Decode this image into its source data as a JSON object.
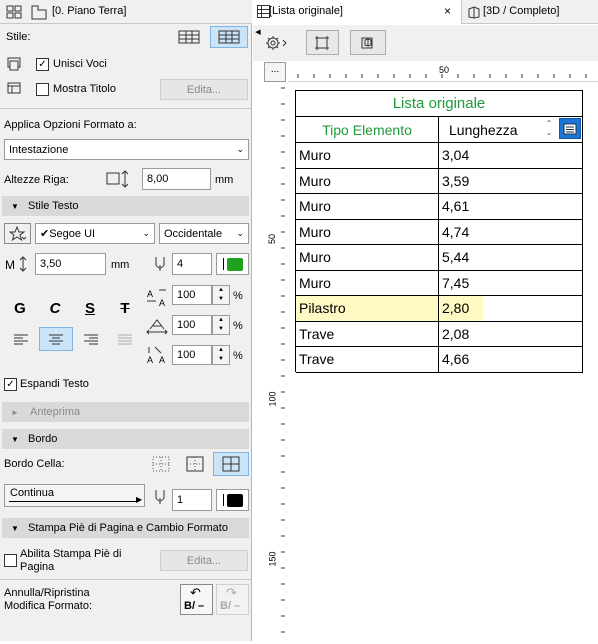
{
  "left_panel": {
    "view_title": "[0. Piano Terra]",
    "stile_label": "Stile:",
    "unisci_voci_label": "Unisci Voci",
    "unisci_voci_checked": true,
    "mostra_titolo_label": "Mostra Titolo",
    "mostra_titolo_checked": false,
    "edita_label": "Edita...",
    "applica_label": "Applica Opzioni Formato a:",
    "applica_value": "Intestazione",
    "altezze_label": "Altezze Riga:",
    "altezze_value": "8,00",
    "altezze_unit": "mm",
    "stile_testo_label": "Stile Testo",
    "font_value": "✔Segoe UI",
    "script_value": "Occidentale",
    "font_size_value": "3,50",
    "font_size_unit": "mm",
    "pen_value": "4",
    "pen_color": "#1fa31f",
    "style_buttons": [
      "G",
      "C",
      "S",
      "T"
    ],
    "width_value": "100",
    "spacing_value": "100",
    "height_value": "100",
    "percent": "%",
    "espandi_label": "Espandi Testo",
    "espandi_checked": true,
    "anteprima_label": "Anteprima",
    "bordo_label": "Bordo",
    "bordo_cella_label": "Bordo Cella:",
    "line_type_value": "Continua",
    "line_pen_value": "1",
    "line_pen_color": "#000000",
    "stampa_label": "Stampa Piè di Pagina e Cambio Formato",
    "abilita_label": "Abilita Stampa Piè di Pagina",
    "abilita_checked": false,
    "edita2_label": "Edita...",
    "annulla_label": "Annulla/Ripristina Modifica Formato:",
    "undo_label": "B/ –",
    "redo_label": "B/ –"
  },
  "tabs": [
    {
      "label": "[Lista originale]",
      "active": true
    },
    {
      "label": "[3D / Completo]",
      "active": false
    }
  ],
  "ruler": {
    "more_label": "...",
    "h_label": "50",
    "v_labels": [
      "50",
      "100",
      "150"
    ]
  },
  "schedule": {
    "title": "Lista originale",
    "header_col1": "Tipo Elemento",
    "header_col2": "Lunghezza",
    "header_color": "#1f9a3a",
    "highlight_color": "#fff9c4",
    "rows": [
      {
        "tipo": "Muro",
        "lunghezza": "3,04",
        "highlight": false
      },
      {
        "tipo": "Muro",
        "lunghezza": "3,59",
        "highlight": false
      },
      {
        "tipo": "Muro",
        "lunghezza": "4,61",
        "highlight": false
      },
      {
        "tipo": "Muro",
        "lunghezza": "4,74",
        "highlight": false
      },
      {
        "tipo": "Muro",
        "lunghezza": "5,44",
        "highlight": false
      },
      {
        "tipo": "Muro",
        "lunghezza": "7,45",
        "highlight": false
      },
      {
        "tipo": "Pilastro",
        "lunghezza": "2,80",
        "highlight": true
      },
      {
        "tipo": "Trave",
        "lunghezza": "2,08",
        "highlight": false
      },
      {
        "tipo": "Trave",
        "lunghezza": "4,66",
        "highlight": false
      }
    ]
  },
  "icons": {
    "view": "grid-view-icon",
    "floorplan": "floorplan-icon",
    "style_a": "table-style-a-icon",
    "style_b": "table-style-b-icon",
    "merge": "merge-icon",
    "title": "title-icon",
    "row_height": "row-height-icon",
    "font_fav": "favorite-star-icon",
    "font_size": "font-size-icon",
    "pen": "pen-icon",
    "settings": "settings-gear-icon",
    "select": "select-icon",
    "zoom3d": "select-3d-icon"
  }
}
